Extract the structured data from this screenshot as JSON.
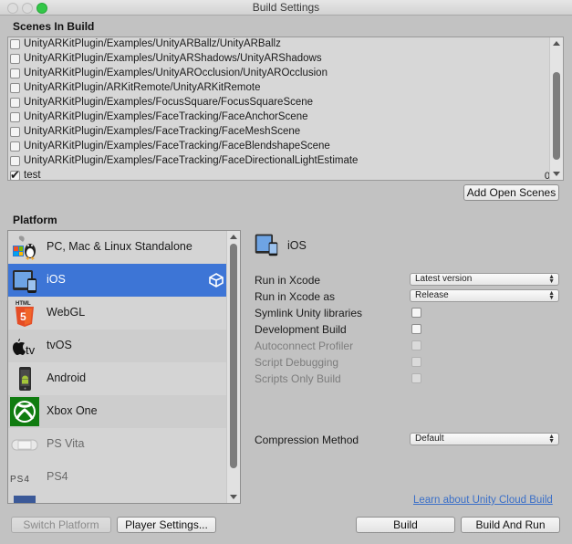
{
  "window": {
    "title": "Build Settings"
  },
  "scenes_section": {
    "label": "Scenes In Build",
    "scenes": [
      {
        "name": "UnityARKitPlugin/Examples/UnityARBallz/UnityARBallz",
        "checked": false,
        "index": ""
      },
      {
        "name": "UnityARKitPlugin/Examples/UnityARShadows/UnityARShadows",
        "checked": false,
        "index": ""
      },
      {
        "name": "UnityARKitPlugin/Examples/UnityAROcclusion/UnityAROcclusion",
        "checked": false,
        "index": ""
      },
      {
        "name": "UnityARKitPlugin/ARKitRemote/UnityARKitRemote",
        "checked": false,
        "index": ""
      },
      {
        "name": "UnityARKitPlugin/Examples/FocusSquare/FocusSquareScene",
        "checked": false,
        "index": ""
      },
      {
        "name": "UnityARKitPlugin/Examples/FaceTracking/FaceAnchorScene",
        "checked": false,
        "index": ""
      },
      {
        "name": "UnityARKitPlugin/Examples/FaceTracking/FaceMeshScene",
        "checked": false,
        "index": ""
      },
      {
        "name": "UnityARKitPlugin/Examples/FaceTracking/FaceBlendshapeScene",
        "checked": false,
        "index": ""
      },
      {
        "name": "UnityARKitPlugin/Examples/FaceTracking/FaceDirectionalLightEstimate",
        "checked": false,
        "index": ""
      },
      {
        "name": "test",
        "checked": true,
        "index": "0"
      }
    ],
    "add_open_scenes": "Add Open Scenes"
  },
  "platform_section": {
    "label": "Platform",
    "platforms": [
      {
        "label": "PC, Mac & Linux Standalone",
        "icon": "standalone-icon",
        "selected": false,
        "dim": false
      },
      {
        "label": "iOS",
        "icon": "ios-device-icon",
        "selected": true,
        "dim": false
      },
      {
        "label": "WebGL",
        "icon": "html5-icon",
        "selected": false,
        "dim": false
      },
      {
        "label": "tvOS",
        "icon": "apple-tv-icon",
        "selected": false,
        "dim": false
      },
      {
        "label": "Android",
        "icon": "android-phone-icon",
        "selected": false,
        "dim": false
      },
      {
        "label": "Xbox One",
        "icon": "xbox-icon",
        "selected": false,
        "dim": false
      },
      {
        "label": "PS Vita",
        "icon": "ps-vita-icon",
        "selected": false,
        "dim": true
      },
      {
        "label": "PS4",
        "icon": "ps4-icon",
        "selected": false,
        "dim": true
      }
    ]
  },
  "settings": {
    "platform_title": "iOS",
    "run_in_xcode": {
      "label": "Run in Xcode",
      "value": "Latest version"
    },
    "run_in_xcode_as": {
      "label": "Run in Xcode as",
      "value": "Release"
    },
    "symlink": {
      "label": "Symlink Unity libraries",
      "checked": false
    },
    "development_build": {
      "label": "Development Build",
      "checked": false
    },
    "autoconnect_profiler": {
      "label": "Autoconnect Profiler",
      "checked": false,
      "disabled": true
    },
    "script_debugging": {
      "label": "Script Debugging",
      "checked": false,
      "disabled": true
    },
    "scripts_only_build": {
      "label": "Scripts Only Build",
      "checked": false,
      "disabled": true
    },
    "compression": {
      "label": "Compression Method",
      "value": "Default"
    },
    "cloud_build_link": "Learn about Unity Cloud Build"
  },
  "footer": {
    "switch_platform": "Switch Platform",
    "player_settings": "Player Settings...",
    "build": "Build",
    "build_and_run": "Build And Run"
  },
  "colors": {
    "selection": "#3d75d6",
    "window_bg": "#c2c2c2",
    "link": "#3a6fc8"
  }
}
